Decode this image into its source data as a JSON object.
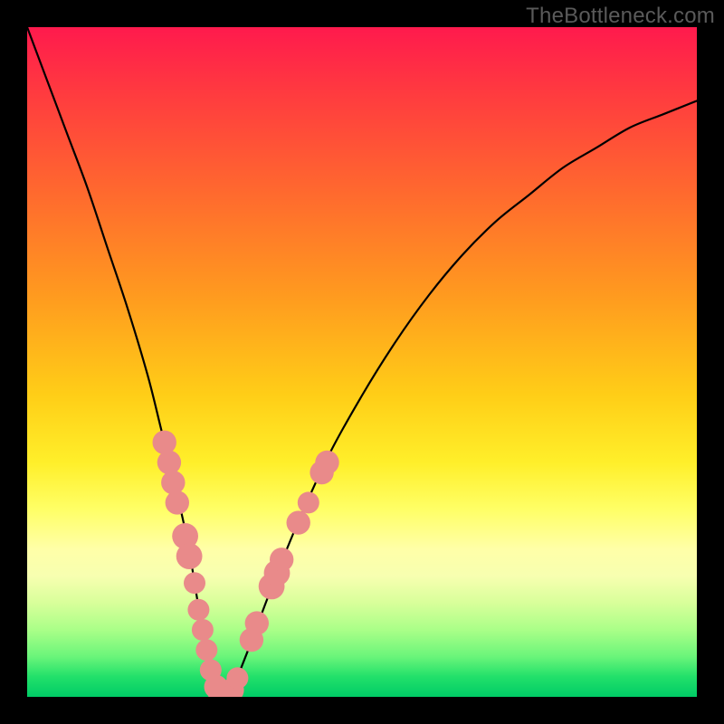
{
  "watermark": {
    "text": "TheBottleneck.com"
  },
  "chart_data": {
    "type": "line",
    "title": "",
    "xlabel": "",
    "ylabel": "",
    "xlim": [
      0,
      100
    ],
    "ylim": [
      0,
      100
    ],
    "series": [
      {
        "name": "bottleneck-curve",
        "x": [
          0,
          3,
          6,
          9,
          12,
          15,
          18,
          20,
          22,
          24,
          25,
          26,
          27,
          28,
          29,
          30,
          31,
          33,
          36,
          40,
          45,
          50,
          55,
          60,
          65,
          70,
          75,
          80,
          85,
          90,
          95,
          100
        ],
        "y": [
          100,
          92,
          84,
          76,
          67,
          58,
          48,
          40,
          32,
          23,
          17,
          11,
          6,
          2,
          0,
          0,
          2,
          7,
          15,
          25,
          36,
          45,
          53,
          60,
          66,
          71,
          75,
          79,
          82,
          85,
          87,
          89
        ]
      }
    ],
    "markers": {
      "name": "highlighted-points",
      "color": "#e98a8a",
      "points": [
        {
          "x": 20.5,
          "y": 38,
          "r": 2.2
        },
        {
          "x": 21.2,
          "y": 35,
          "r": 2.2
        },
        {
          "x": 21.8,
          "y": 32,
          "r": 2.2
        },
        {
          "x": 22.4,
          "y": 29,
          "r": 2.2
        },
        {
          "x": 23.6,
          "y": 24,
          "r": 2.4
        },
        {
          "x": 24.2,
          "y": 21,
          "r": 2.4
        },
        {
          "x": 25.0,
          "y": 17,
          "r": 2.0
        },
        {
          "x": 25.6,
          "y": 13,
          "r": 2.0
        },
        {
          "x": 26.2,
          "y": 10,
          "r": 2.0
        },
        {
          "x": 26.8,
          "y": 7,
          "r": 2.0
        },
        {
          "x": 27.4,
          "y": 4,
          "r": 2.0
        },
        {
          "x": 28.2,
          "y": 1.5,
          "r": 2.2
        },
        {
          "x": 29.0,
          "y": 0.3,
          "r": 2.4
        },
        {
          "x": 29.8,
          "y": 0.2,
          "r": 2.4
        },
        {
          "x": 30.6,
          "y": 1.0,
          "r": 2.2
        },
        {
          "x": 31.4,
          "y": 2.8,
          "r": 2.0
        },
        {
          "x": 33.5,
          "y": 8.5,
          "r": 2.2
        },
        {
          "x": 34.3,
          "y": 11.0,
          "r": 2.2
        },
        {
          "x": 36.5,
          "y": 16.5,
          "r": 2.4
        },
        {
          "x": 37.3,
          "y": 18.5,
          "r": 2.4
        },
        {
          "x": 38.0,
          "y": 20.5,
          "r": 2.2
        },
        {
          "x": 40.5,
          "y": 26.0,
          "r": 2.2
        },
        {
          "x": 42.0,
          "y": 29.0,
          "r": 2.0
        },
        {
          "x": 44.0,
          "y": 33.5,
          "r": 2.2
        },
        {
          "x": 44.8,
          "y": 35.0,
          "r": 2.2
        }
      ]
    },
    "background": {
      "type": "vertical-gradient",
      "stops": [
        {
          "pos": 0.0,
          "color": "#ff1a4d"
        },
        {
          "pos": 0.4,
          "color": "#ff9a1f"
        },
        {
          "pos": 0.7,
          "color": "#ffef2a"
        },
        {
          "pos": 0.88,
          "color": "#c8ff90"
        },
        {
          "pos": 1.0,
          "color": "#00cc66"
        }
      ]
    }
  }
}
